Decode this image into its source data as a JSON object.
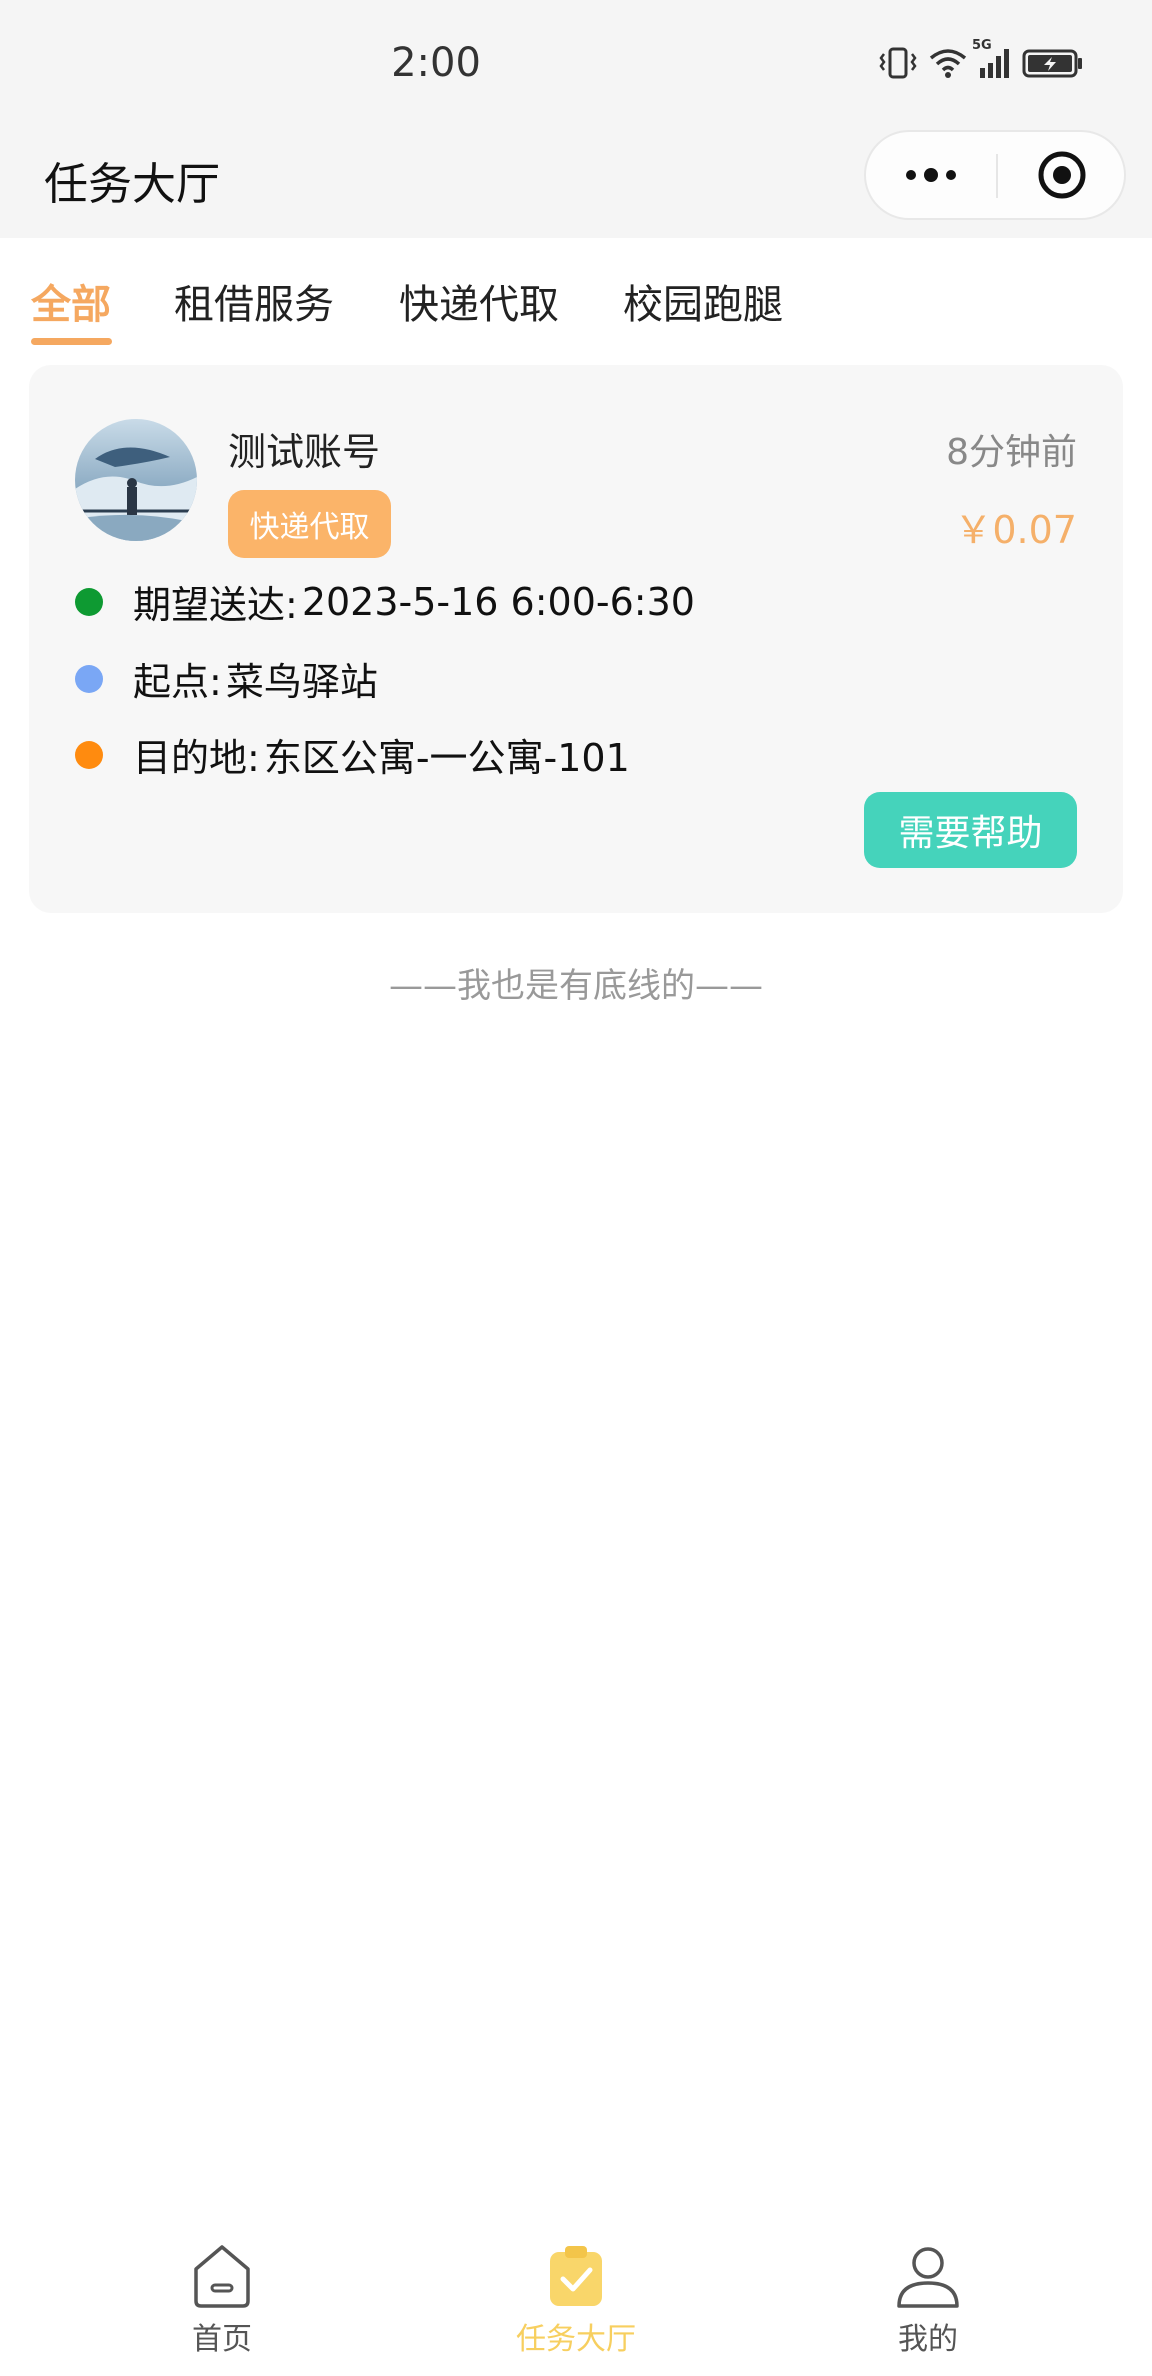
{
  "status_bar": {
    "time": "2:00",
    "network": "5G",
    "icons": [
      "vibrate-icon",
      "wifi-icon",
      "signal-icon",
      "battery-icon"
    ]
  },
  "nav": {
    "title": "任务大厅",
    "menu_icon": "more-dots-icon",
    "close_icon": "target-icon"
  },
  "tabs": [
    {
      "label": "全部",
      "active": true
    },
    {
      "label": "租借服务",
      "active": false
    },
    {
      "label": "快递代取",
      "active": false
    },
    {
      "label": "校园跑腿",
      "active": false
    }
  ],
  "task": {
    "username": "测试账号",
    "category": "快递代取",
    "time_ago": "8分钟前",
    "price": "￥0.07",
    "expected_label": "期望送达:",
    "expected_value": "2023-5-16 6:00-6:30",
    "origin_label": "起点:",
    "origin_value": "菜鸟驿站",
    "destination_label": "目的地:",
    "destination_value": "东区公寓-一公寓-101",
    "help_button": "需要帮助"
  },
  "bottom_line": "——我也是有底线的——",
  "tabbar": [
    {
      "label": "首页",
      "icon": "home-icon",
      "active": false
    },
    {
      "label": "任务大厅",
      "icon": "task-clipboard-icon",
      "active": true
    },
    {
      "label": "我的",
      "icon": "user-icon",
      "active": false
    }
  ],
  "colors": {
    "accent_orange": "#f5a860",
    "badge_orange": "#fbb469",
    "help_green": "#45d3bb",
    "dot_green": "#0e9a32",
    "dot_blue": "#7aa7f5",
    "dot_orange": "#ff8b0f",
    "tab_active_yellow": "#f7cf5f"
  }
}
